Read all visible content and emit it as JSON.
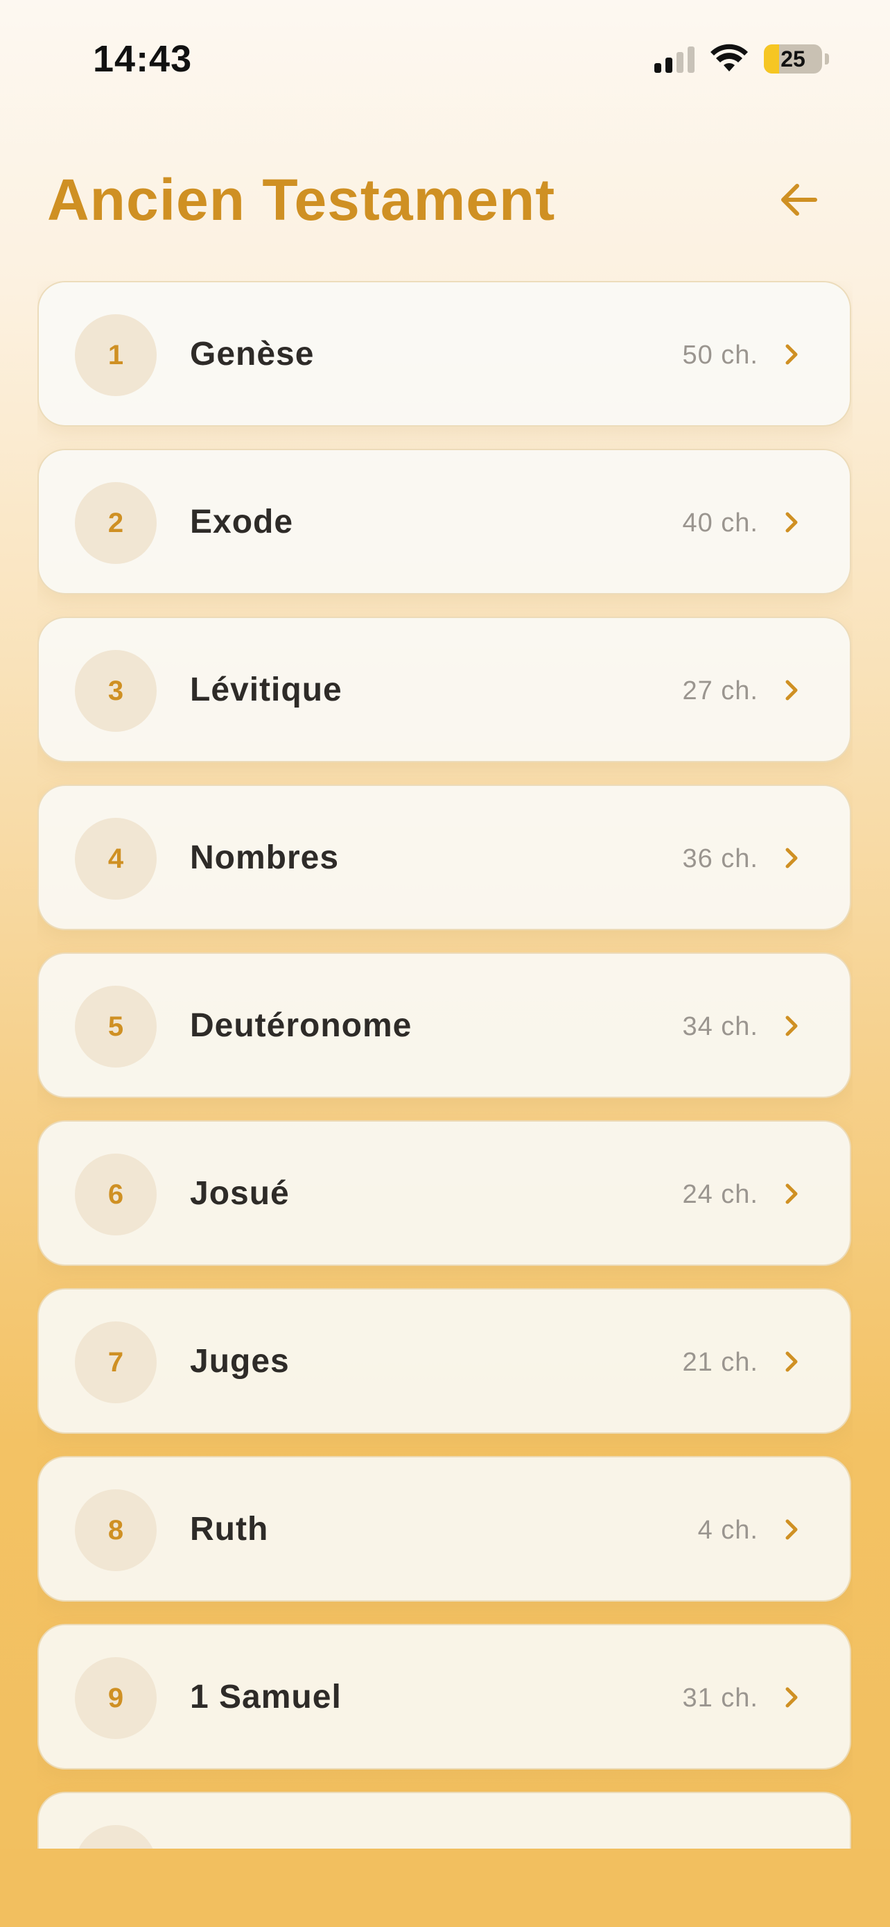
{
  "status_bar": {
    "time": "14:43",
    "battery": "25"
  },
  "header": {
    "title": "Ancien Testament",
    "back_icon": "arrow-left-icon"
  },
  "colors": {
    "accent": "#cf9023",
    "text": "#2e2b28",
    "muted": "#9a958f",
    "circle_bg": "#f1e6d3"
  },
  "books": [
    {
      "number": "1",
      "name": "Genèse",
      "chapters": "50 ch."
    },
    {
      "number": "2",
      "name": "Exode",
      "chapters": "40 ch."
    },
    {
      "number": "3",
      "name": "Lévitique",
      "chapters": "27 ch."
    },
    {
      "number": "4",
      "name": "Nombres",
      "chapters": "36 ch."
    },
    {
      "number": "5",
      "name": "Deutéronome",
      "chapters": "34 ch."
    },
    {
      "number": "6",
      "name": "Josué",
      "chapters": "24 ch."
    },
    {
      "number": "7",
      "name": "Juges",
      "chapters": "21 ch."
    },
    {
      "number": "8",
      "name": "Ruth",
      "chapters": "4 ch."
    },
    {
      "number": "9",
      "name": "1 Samuel",
      "chapters": "31 ch."
    },
    {
      "number": "",
      "name": "",
      "chapters": ""
    }
  ]
}
